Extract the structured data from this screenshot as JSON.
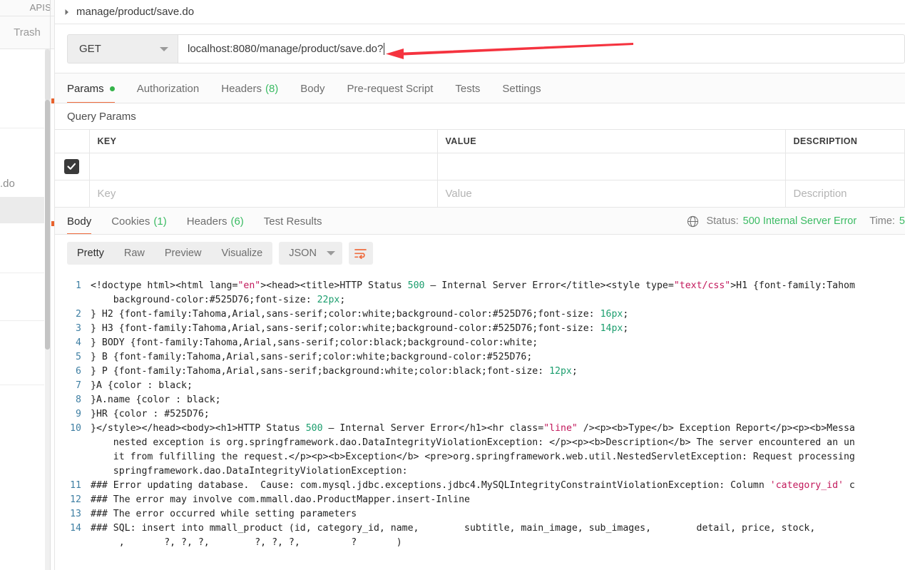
{
  "sidebar": {
    "tab_label": "APIS",
    "trash_label": "Trash",
    "items": [
      {
        "label": ""
      },
      {
        "label": ""
      },
      {
        "label": ".do"
      },
      {
        "label": "",
        "selected": true
      },
      {
        "label": ""
      },
      {
        "label": ""
      },
      {
        "label": ""
      }
    ]
  },
  "breadcrumb": {
    "caret_icon": "chevron-right-icon",
    "text": "manage/product/save.do"
  },
  "request": {
    "method": "GET",
    "method_caret_icon": "chevron-down-icon",
    "url": "localhost:8080/manage/product/save.do?",
    "tabs": [
      {
        "label": "Params",
        "active": true,
        "dot": true
      },
      {
        "label": "Authorization",
        "active": false
      },
      {
        "label": "Headers",
        "active": false,
        "count": "(8)"
      },
      {
        "label": "Body",
        "active": false
      },
      {
        "label": "Pre-request Script",
        "active": false
      },
      {
        "label": "Tests",
        "active": false
      },
      {
        "label": "Settings",
        "active": false
      }
    ]
  },
  "query_params": {
    "title": "Query Params",
    "columns": [
      "KEY",
      "VALUE",
      "DESCRIPTION"
    ],
    "rows": [
      {
        "checked": true,
        "key": "",
        "value": "",
        "description": ""
      },
      {
        "checked": false,
        "key": "Key",
        "value": "Value",
        "description": "Description",
        "placeholder_row": true
      }
    ]
  },
  "response": {
    "tabs": [
      {
        "label": "Body",
        "active": true
      },
      {
        "label": "Cookies",
        "active": false,
        "count": "(1)"
      },
      {
        "label": "Headers",
        "active": false,
        "count": "(6)"
      },
      {
        "label": "Test Results",
        "active": false
      }
    ],
    "globe_icon": "globe-icon",
    "status_label": "Status:",
    "status_value": "500 Internal Server Error",
    "time_label": "Time:",
    "time_value": "5",
    "status_color": "#3bbb63"
  },
  "viewer": {
    "modes": [
      {
        "label": "Pretty",
        "active": true
      },
      {
        "label": "Raw",
        "active": false
      },
      {
        "label": "Preview",
        "active": false
      },
      {
        "label": "Visualize",
        "active": false
      }
    ],
    "format": "JSON",
    "format_caret_icon": "chevron-down-icon",
    "wrap_icon": "word-wrap-icon"
  },
  "code": {
    "lines": [
      {
        "n": "1",
        "text": "<!doctype html><html lang=\"en\"><head><title>HTTP Status 500 – Internal Server Error</title><style type=\"text/css\">H1 {font-family:Tahom"
      },
      {
        "n": "",
        "text": "    background-color:#525D76;font-size: 22px;"
      },
      {
        "n": "2",
        "text": "} H2 {font-family:Tahoma,Arial,sans-serif;color:white;background-color:#525D76;font-size: 16px;"
      },
      {
        "n": "3",
        "text": "} H3 {font-family:Tahoma,Arial,sans-serif;color:white;background-color:#525D76;font-size: 14px;"
      },
      {
        "n": "4",
        "text": "} BODY {font-family:Tahoma,Arial,sans-serif;color:black;background-color:white;"
      },
      {
        "n": "5",
        "text": "} B {font-family:Tahoma,Arial,sans-serif;color:white;background-color:#525D76;"
      },
      {
        "n": "6",
        "text": "} P {font-family:Tahoma,Arial,sans-serif;background:white;color:black;font-size: 12px;"
      },
      {
        "n": "7",
        "text": "}A {color : black;"
      },
      {
        "n": "8",
        "text": "}A.name {color : black;"
      },
      {
        "n": "9",
        "text": "}HR {color : #525D76;"
      },
      {
        "n": "10",
        "text": "}</style></head><body><h1>HTTP Status 500 – Internal Server Error</h1><hr class=\"line\" /><p><b>Type</b> Exception Report</p><p><b>Messa"
      },
      {
        "n": "",
        "text": "    nested exception is org.springframework.dao.DataIntegrityViolationException: </p><p><b>Description</b> The server encountered an un"
      },
      {
        "n": "",
        "text": "    it from fulfilling the request.</p><p><b>Exception</b> <pre>org.springframework.web.util.NestedServletException: Request processing"
      },
      {
        "n": "",
        "text": "    springframework.dao.DataIntegrityViolationException:"
      },
      {
        "n": "11",
        "text": "### Error updating database.  Cause: com.mysql.jdbc.exceptions.jdbc4.MySQLIntegrityConstraintViolationException: Column 'category_id' c"
      },
      {
        "n": "12",
        "text": "### The error may involve com.mmall.dao.ProductMapper.insert-Inline"
      },
      {
        "n": "13",
        "text": "### The error occurred while setting parameters"
      },
      {
        "n": "14",
        "text": "### SQL: insert into mmall_product (id, category_id, name,        subtitle, main_image, sub_images,        detail, price, stock,"
      },
      {
        "n": "",
        "text": "     ,       ?, ?, ?,        ?, ?, ?,         ?       )"
      }
    ]
  },
  "annotation": {
    "arrow_icon": "red-arrow-left",
    "color": "#f5333f"
  }
}
